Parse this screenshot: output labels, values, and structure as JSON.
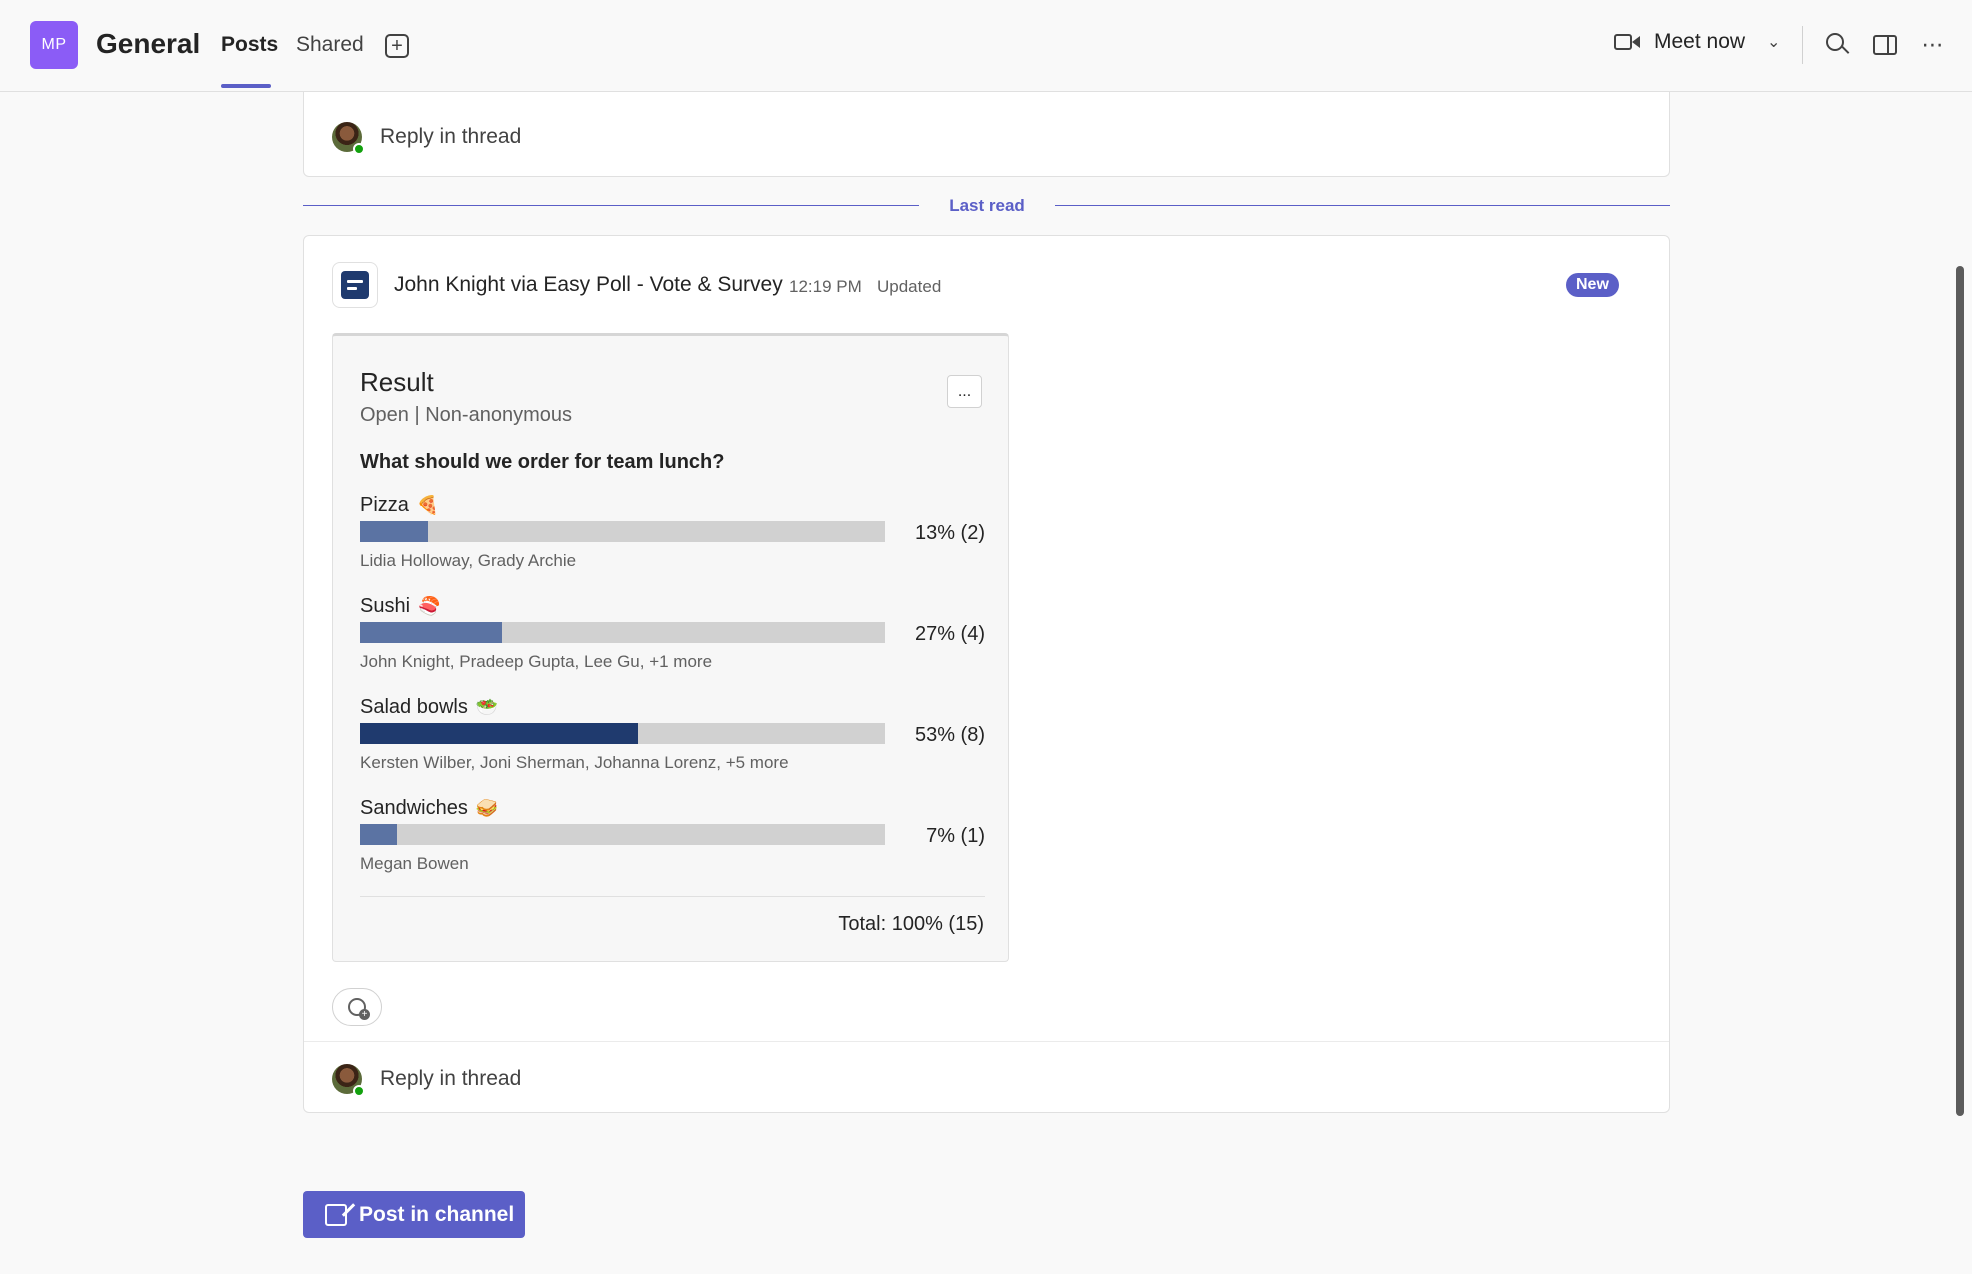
{
  "header": {
    "team_initials": "MP",
    "channel": "General",
    "tabs": [
      {
        "label": "Posts",
        "active": true
      },
      {
        "label": "Shared",
        "active": false
      }
    ],
    "add_tab_icon": "plus-square-icon",
    "meet_now": "Meet now",
    "icons": [
      "video-camera-icon",
      "chevron-down-icon",
      "search-icon",
      "side-panel-icon",
      "more-icon"
    ]
  },
  "reply_label": "Reply in thread",
  "last_read": "Last read",
  "message": {
    "author": "John Knight via Easy Poll - Vote & Survey",
    "time": "12:19 PM",
    "status": "Updated",
    "badge": "New"
  },
  "poll": {
    "title": "Result",
    "subtitle": "Open | Non-anonymous",
    "menu_label": "...",
    "question": "What should we order for team lunch?",
    "options": [
      {
        "label": "Pizza",
        "emoji": "🍕",
        "percent": 13,
        "percent_label": "13% (2)",
        "voters": "Lidia Holloway, Grady Archie",
        "lead": false
      },
      {
        "label": "Sushi",
        "emoji": "🍣",
        "percent": 27,
        "percent_label": "27% (4)",
        "voters": "John Knight, Pradeep Gupta, Lee Gu, +1 more",
        "lead": false
      },
      {
        "label": "Salad bowls",
        "emoji": "🥗",
        "percent": 53,
        "percent_label": "53% (8)",
        "voters": "Kersten Wilber, Joni Sherman, Johanna Lorenz, +5 more",
        "lead": true
      },
      {
        "label": "Sandwiches",
        "emoji": "🥪",
        "percent": 7,
        "percent_label": "7% (1)",
        "voters": "Megan Bowen",
        "lead": false
      }
    ],
    "total": "Total: 100% (15)"
  },
  "post_button": "Post in channel",
  "colors": {
    "accent": "#5b5fc7",
    "bar_fill": "#5b73a3",
    "bar_fill_lead": "#1f3a6e",
    "bar_track": "#d1d1d1",
    "presence": "#13a10e"
  }
}
